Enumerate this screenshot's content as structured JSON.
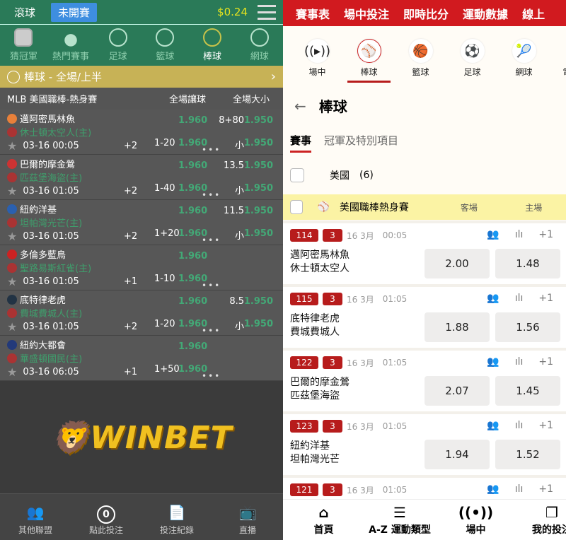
{
  "left": {
    "tabs": [
      "滾球",
      "未開賽"
    ],
    "balance": "$0.24",
    "sports": [
      {
        "label": "猜冠軍",
        "icon": "trophy-icon"
      },
      {
        "label": "熱門賽事",
        "icon": "fire-icon"
      },
      {
        "label": "足球",
        "icon": "soccer-icon"
      },
      {
        "label": "籃球",
        "icon": "basketball-icon"
      },
      {
        "label": "棒球",
        "icon": "baseball-icon"
      },
      {
        "label": "網球",
        "icon": "tennis-icon"
      }
    ],
    "section_title": "棒球 - 全場/上半",
    "header": {
      "league": "MLB 美國職棒-熱身賽",
      "handicap": "全場讓球",
      "total": "全場大小"
    },
    "matches": [
      {
        "away": "邁阿密馬林魚",
        "home": "休士頓太空人(主)",
        "time": "03-16 00:05",
        "more": "+2",
        "line": "1-20",
        "hc_away": "1.960",
        "hc_home": "1.960",
        "total": "8+80",
        "over": "1.950",
        "under_label": "小",
        "under": "1.950"
      },
      {
        "away": "巴爾的摩金鶯",
        "home": "匹茲堡海盜(主)",
        "time": "03-16 01:05",
        "more": "+2",
        "line": "1-40",
        "hc_away": "1.960",
        "hc_home": "1.960",
        "total": "13.5",
        "over": "1.950",
        "under_label": "小",
        "under": "1.950"
      },
      {
        "away": "紐約洋基",
        "home": "坦帕灣光芒(主)",
        "time": "03-16 01:05",
        "more": "+2",
        "line": "1+20",
        "hc_away": "1.960",
        "hc_home": "1.960",
        "total": "11.5",
        "over": "1.950",
        "under_label": "小",
        "under": "1.950"
      },
      {
        "away": "多倫多藍鳥",
        "home": "聖路易斯紅雀(主)",
        "time": "03-16 01:05",
        "more": "+1",
        "line": "1-10",
        "hc_away": "1.960",
        "hc_home": "1.960"
      },
      {
        "away": "底特律老虎",
        "home": "費城費城人(主)",
        "time": "03-16 01:05",
        "more": "+2",
        "line": "1-20",
        "hc_away": "1.960",
        "hc_home": "1.960",
        "total": "8.5",
        "over": "1.950",
        "under_label": "小",
        "under": "1.950"
      },
      {
        "away": "紐約大都會",
        "home": "華盛頓國民(主)",
        "time": "03-16 06:05",
        "more": "+1",
        "line": "1+50",
        "hc_away": "1.960",
        "hc_home": "1.960"
      }
    ],
    "logo": "WINBET",
    "nav": [
      {
        "label": "其他聯盟",
        "icon": "people-icon"
      },
      {
        "label": "點此投注",
        "icon": "bet-count-icon",
        "count": "0"
      },
      {
        "label": "投注紀錄",
        "icon": "document-icon"
      },
      {
        "label": "直播",
        "icon": "tv-icon"
      }
    ]
  },
  "right": {
    "top_tabs": [
      "賽事表",
      "場中投注",
      "即時比分",
      "運動數據",
      "線上"
    ],
    "sports": [
      {
        "label": "場中",
        "icon": "live-icon"
      },
      {
        "label": "棒球",
        "icon": "baseball-icon"
      },
      {
        "label": "籃球",
        "icon": "basketball-icon"
      },
      {
        "label": "足球",
        "icon": "soccer-icon"
      },
      {
        "label": "網球",
        "icon": "tennis-icon"
      },
      {
        "label": "電子競",
        "icon": "esports-icon"
      }
    ],
    "title": "棒球",
    "tabs": [
      "賽事",
      "冠軍及特別項目"
    ],
    "country": {
      "name": "美國",
      "count": "(6)"
    },
    "league": {
      "name": "美國職棒熱身賽",
      "away": "客場",
      "home": "主場"
    },
    "matches": [
      {
        "id": "114",
        "badge": "3",
        "date": "16 3月",
        "time": "00:05",
        "more": "+1",
        "away": "邁阿密馬林魚",
        "home": "休士頓太空人",
        "odd_away": "2.00",
        "odd_home": "1.48"
      },
      {
        "id": "115",
        "badge": "3",
        "date": "16 3月",
        "time": "01:05",
        "more": "+1",
        "away": "底特律老虎",
        "home": "費城費城人",
        "odd_away": "1.88",
        "odd_home": "1.56"
      },
      {
        "id": "122",
        "badge": "3",
        "date": "16 3月",
        "time": "01:05",
        "more": "+1",
        "away": "巴爾的摩金鶯",
        "home": "匹茲堡海盜",
        "odd_away": "2.07",
        "odd_home": "1.45"
      },
      {
        "id": "123",
        "badge": "3",
        "date": "16 3月",
        "time": "01:05",
        "more": "+1",
        "away": "紐約洋基",
        "home": "坦帕灣光芒",
        "odd_away": "1.94",
        "odd_home": "1.52"
      },
      {
        "id": "121",
        "badge": "3",
        "date": "16 3月",
        "time": "01:05",
        "more": "+1"
      }
    ],
    "nav": [
      {
        "label": "首頁",
        "icon": "home-icon"
      },
      {
        "label": "A-Z 運動類型",
        "icon": "menu-icon"
      },
      {
        "label": "場中",
        "icon": "live-icon"
      },
      {
        "label": "我的投注",
        "icon": "copy-icon"
      }
    ]
  }
}
